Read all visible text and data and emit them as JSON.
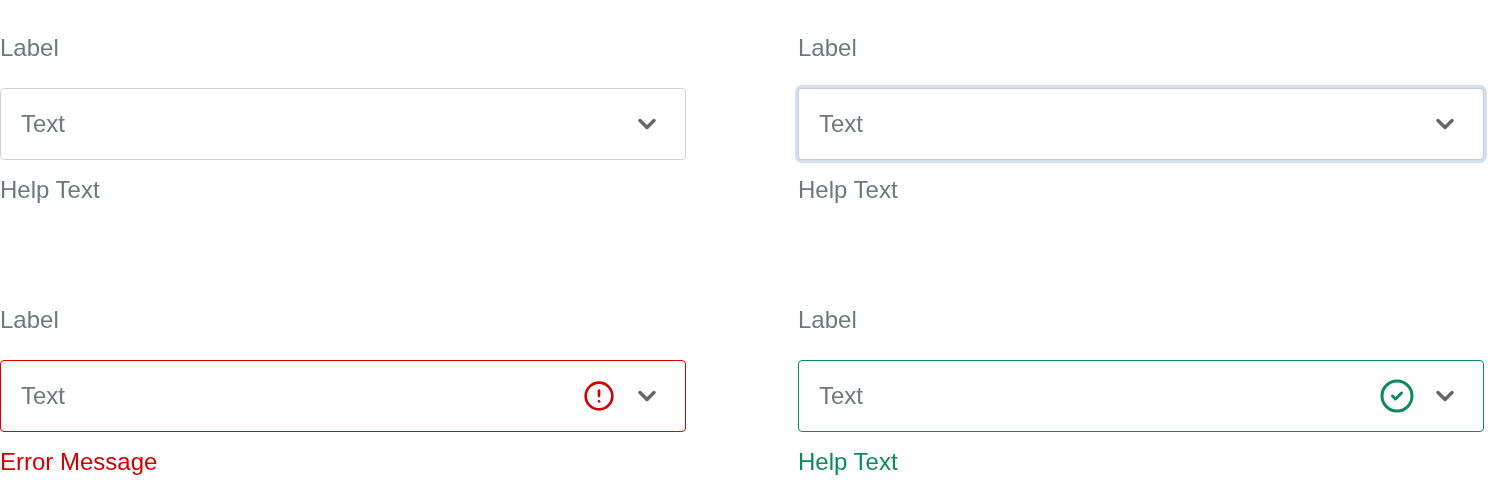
{
  "fields": [
    {
      "label": "Label",
      "value": "Text",
      "message": "Help Text",
      "kind": "default"
    },
    {
      "label": "Label",
      "value": "Text",
      "message": "Help Text",
      "kind": "focused"
    },
    {
      "label": "Label",
      "value": "Text",
      "message": "Error Message",
      "kind": "error"
    },
    {
      "label": "Label",
      "value": "Text",
      "message": "Help Text",
      "kind": "success"
    }
  ]
}
